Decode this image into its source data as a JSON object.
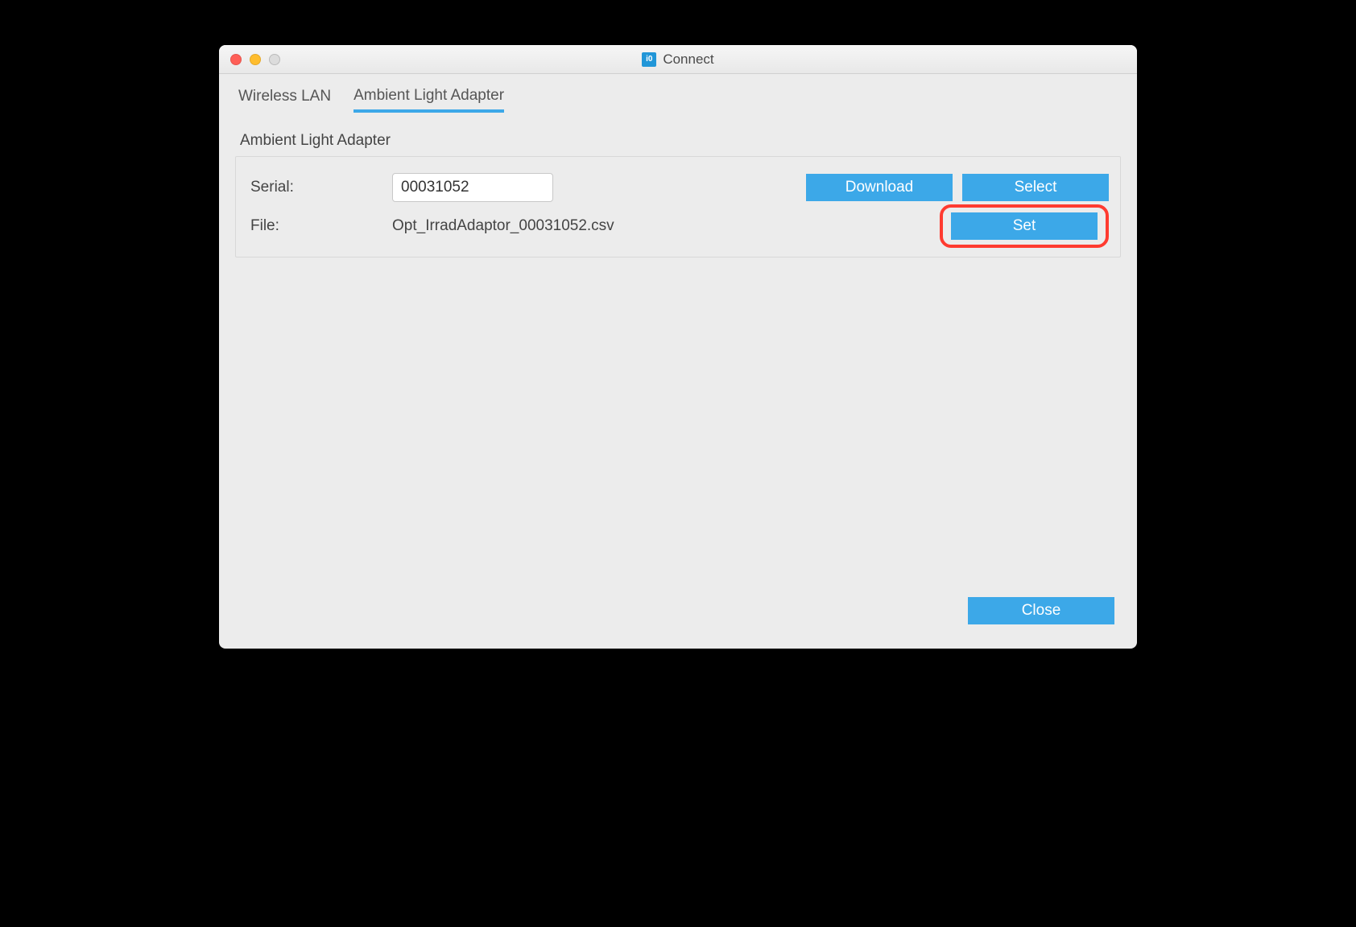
{
  "window": {
    "title": "Connect"
  },
  "tabs": {
    "wireless": "Wireless LAN",
    "ambient": "Ambient Light Adapter"
  },
  "section": {
    "title": "Ambient Light Adapter"
  },
  "form": {
    "serial_label": "Serial:",
    "serial_value": "00031052",
    "file_label": "File:",
    "file_value": "Opt_IrradAdaptor_00031052.csv"
  },
  "buttons": {
    "download": "Download",
    "select": "Select",
    "set": "Set",
    "close": "Close"
  }
}
